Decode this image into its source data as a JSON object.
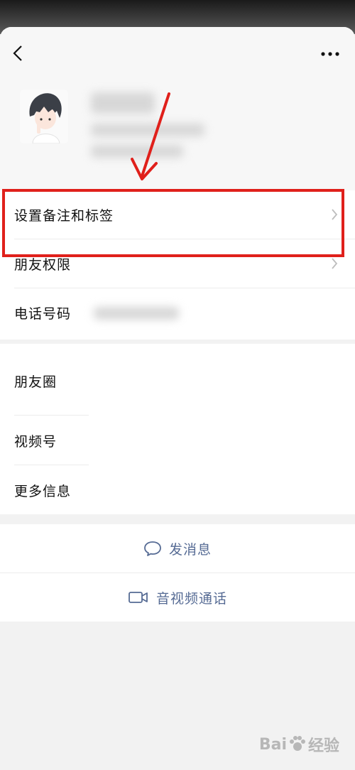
{
  "rows": {
    "remark_tags": "设置备注和标签",
    "permissions": "朋友权限",
    "phone": "电话号码",
    "moments": "朋友圈",
    "channels": "视频号",
    "more_info": "更多信息"
  },
  "actions": {
    "message": "发消息",
    "call": "音视频通话"
  },
  "watermark": {
    "text_latin": "Bai",
    "text_cn": "经验"
  },
  "colors": {
    "highlight": "#e0201b",
    "action_text": "#566b94"
  },
  "icons": [
    "back-arrow-icon",
    "more-icon",
    "chevron-right-icon",
    "chat-bubble-icon",
    "video-camera-icon",
    "paw-icon"
  ]
}
